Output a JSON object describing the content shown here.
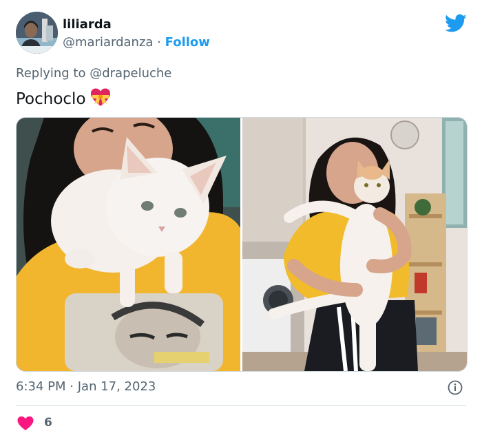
{
  "author": {
    "name": "liliarda",
    "handle": "@mariardanza",
    "separator": "·",
    "follow_label": "Follow"
  },
  "reply": {
    "prefix": "Replying to",
    "mention": "@drapeluche"
  },
  "tweet": {
    "text": "Pochoclo"
  },
  "meta": {
    "time": "6:34 PM",
    "separator": "·",
    "date": "Jan 17, 2023"
  },
  "likes": {
    "count": "6"
  },
  "colors": {
    "accent": "#1d9bf0",
    "secondary_text": "#536471",
    "like": "#f91880"
  },
  "icons": {
    "brand": "twitter-bird-icon",
    "info": "info-icon",
    "like": "heart-icon",
    "emoji": "heart-with-ribbon-emoji"
  }
}
